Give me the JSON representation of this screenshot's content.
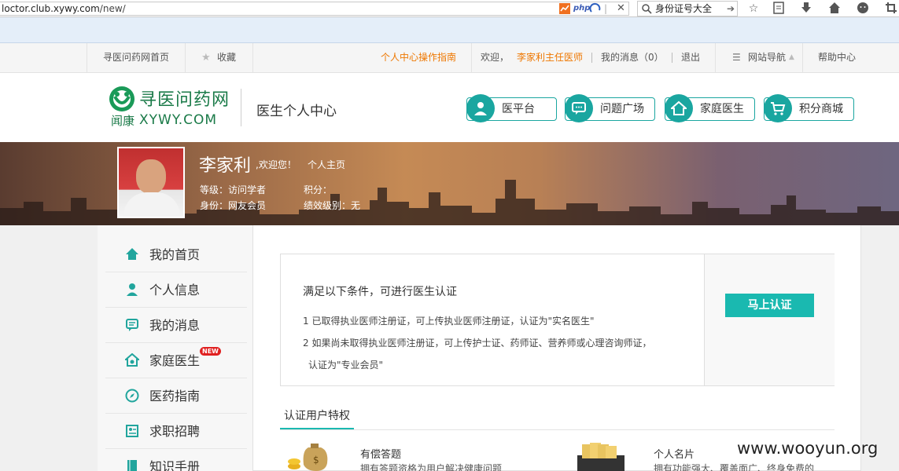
{
  "browser": {
    "url_host": "loctor.club.xywy.com",
    "url_path": "/new/",
    "ext_label": "php",
    "search_value": "身份证号大全"
  },
  "top_nav": {
    "home": "寻医问药网首页",
    "favorite": "收藏",
    "guide": "个人中心操作指南",
    "welcome": "欢迎，",
    "user": "李家利主任医师",
    "messages": "我的消息（0）",
    "logout": "退出",
    "site_nav": "网站导航",
    "help": "帮助中心"
  },
  "header": {
    "logo_title": "寻医问药网",
    "logo_sub": "闻康",
    "logo_en": "XYWY.COM",
    "center_title": "医生个人中心",
    "nav": [
      "医平台",
      "问题广场",
      "家庭医生",
      "积分商城"
    ]
  },
  "profile": {
    "name": "李家利",
    "welcome": ",欢迎您！",
    "homepage": "个人主页",
    "level": "等级：访问学者",
    "points": "积分：",
    "identity": "身份：网友会员",
    "performance": "绩效级别：无"
  },
  "sidebar": {
    "items": [
      {
        "label": "我的首页",
        "icon": "home-icon"
      },
      {
        "label": "个人信息",
        "icon": "user-icon"
      },
      {
        "label": "我的消息",
        "icon": "message-icon"
      },
      {
        "label": "家庭医生",
        "icon": "family-doctor-icon",
        "badge": "NEW"
      },
      {
        "label": "医药指南",
        "icon": "compass-icon"
      },
      {
        "label": "求职招聘",
        "icon": "resume-icon"
      },
      {
        "label": "知识手册",
        "icon": "book-icon"
      }
    ]
  },
  "certification": {
    "title": "满足以下条件，可进行医生认证",
    "line1": "1 已取得执业医师注册证，可上传执业医师注册证，认证为\"实名医生\"",
    "line2": "2 如果尚未取得执业医师注册证，可上传护士证、药师证、营养师或心理咨询师证，",
    "line3": "认证为\"专业会员\"",
    "button": "马上认证"
  },
  "privileges": {
    "tab": "认证用户特权",
    "items": [
      {
        "title": "有偿答题",
        "desc": "拥有答题资格为用户解决健康问题"
      },
      {
        "title": "个人名片",
        "desc": "拥有功能强大、覆盖面广、终身免费的"
      }
    ]
  },
  "watermark": "www.wooyun.org",
  "colors": {
    "accent": "#1ab9b0",
    "teal_nav": "#1aa6a0",
    "orange": "#ee7700",
    "logo_green": "#1a7a48"
  }
}
